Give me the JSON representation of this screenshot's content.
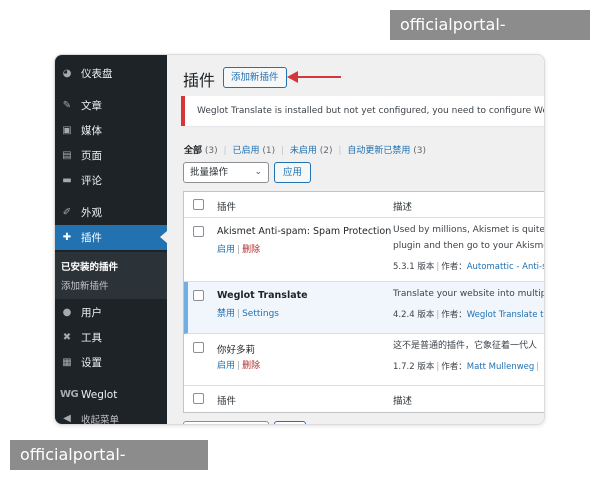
{
  "watermarks": {
    "top": "officialportal-leisu.com",
    "bottom": "officialportal-leisu.com"
  },
  "sidebar": {
    "items": [
      {
        "label": "仪表盘",
        "icon": "dashboard-icon"
      },
      {
        "label": "文章",
        "icon": "pin-icon"
      },
      {
        "label": "媒体",
        "icon": "media-icon"
      },
      {
        "label": "页面",
        "icon": "page-icon"
      },
      {
        "label": "评论",
        "icon": "comment-icon"
      },
      {
        "label": "外观",
        "icon": "brush-icon"
      },
      {
        "label": "插件",
        "icon": "plugin-icon"
      },
      {
        "label": "用户",
        "icon": "user-icon"
      },
      {
        "label": "工具",
        "icon": "wrench-icon"
      },
      {
        "label": "设置",
        "icon": "settings-icon"
      },
      {
        "label": "Weglot",
        "icon": "weglot-logo",
        "logo_text": "WG"
      },
      {
        "label": "收起菜单",
        "icon": "collapse-icon"
      }
    ],
    "submenu": {
      "installed": "已安装的插件",
      "add_new": "添加新插件"
    }
  },
  "header": {
    "title": "插件",
    "add_new_button": "添加新插件"
  },
  "notice": {
    "text": "Weglot Translate is installed but not yet configured, you need to configure Weglot he"
  },
  "filters": {
    "all": {
      "label": "全部",
      "count": "(3)"
    },
    "active": {
      "label": "已启用",
      "count": "(1)"
    },
    "inactive": {
      "label": "未启用",
      "count": "(2)"
    },
    "autoupdate": {
      "label": "自动更新已禁用",
      "count": "(3)"
    }
  },
  "bulk": {
    "select_value": "批量操作",
    "apply": "应用"
  },
  "table": {
    "col_plugin": "插件",
    "col_desc": "描述",
    "rows": [
      {
        "name": "Akismet Anti-spam: Spam Protection",
        "action1": "启用",
        "action2": "删除",
        "desc_line1": "Used by millions, Akismet is quite pos",
        "desc_line2": "plugin and then go to your Akismet S",
        "version": "5.3.1 版本",
        "author_label": "作者：",
        "author": "Automattic - Anti-s"
      },
      {
        "name": "Weglot Translate",
        "action1": "禁用",
        "action2": "Settings",
        "desc_line1": "Translate your website into multiple la",
        "version": "4.2.4 版本",
        "author_label": "作者：",
        "author": "Weglot Translate te"
      },
      {
        "name": "你好多莉",
        "action1": "启用",
        "action2": "删除",
        "desc_line1": "这不是普通的插件，它象征着一代人",
        "version": "1.7.2 版本",
        "author_label": "作者：",
        "author": "Matt Mullenweg"
      }
    ]
  },
  "colors": {
    "sidebar_bg": "#1d2327",
    "accent": "#2271b1",
    "notice_border": "#d63638",
    "arrow": "#d63638",
    "active_row_border": "#72aee6"
  }
}
